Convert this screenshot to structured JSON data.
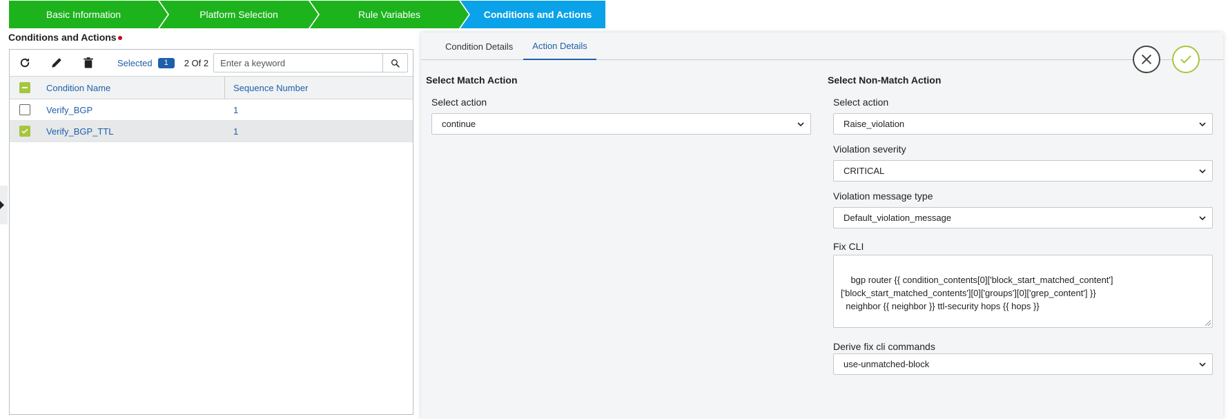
{
  "wizard": {
    "steps": [
      {
        "label": "Basic Information"
      },
      {
        "label": "Platform Selection"
      },
      {
        "label": "Rule Variables"
      },
      {
        "label": "Conditions and Actions"
      }
    ]
  },
  "left": {
    "section_title": "Conditions and Actions",
    "toolbar": {
      "selected_label": "Selected",
      "selected_count": "1",
      "count_text": "2 Of 2",
      "search_placeholder": "Enter a keyword"
    },
    "grid": {
      "headers": {
        "name": "Condition Name",
        "sequence": "Sequence Number"
      },
      "rows": [
        {
          "name": "Verify_BGP",
          "sequence": "1",
          "checked": false
        },
        {
          "name": "Verify_BGP_TTL",
          "sequence": "1",
          "checked": true
        }
      ]
    }
  },
  "right": {
    "tabs": [
      {
        "label": "Condition Details"
      },
      {
        "label": "Action Details"
      }
    ],
    "match": {
      "title": "Select Match Action",
      "select_action_label": "Select action",
      "select_action_value": "continue"
    },
    "nonmatch": {
      "title": "Select Non-Match Action",
      "select_action_label": "Select action",
      "select_action_value": "Raise_violation",
      "severity_label": "Violation severity",
      "severity_value": "CRITICAL",
      "message_type_label": "Violation message type",
      "message_type_value": "Default_violation_message",
      "fix_cli_label": "Fix CLI",
      "fix_cli_value": "bgp router {{ condition_contents[0]['block_start_matched_content']\n['block_start_matched_contents'][0]['groups'][0]['grep_content'] }}\n  neighbor {{ neighbor }} ttl-security hops {{ hops }}",
      "derive_label": "Derive fix cli commands",
      "derive_value": "use-unmatched-block"
    }
  },
  "colors": {
    "step_done": "#1db31d",
    "step_active": "#0aa2e8",
    "link_blue": "#1f5fa8",
    "check_green": "#a6c63c"
  }
}
